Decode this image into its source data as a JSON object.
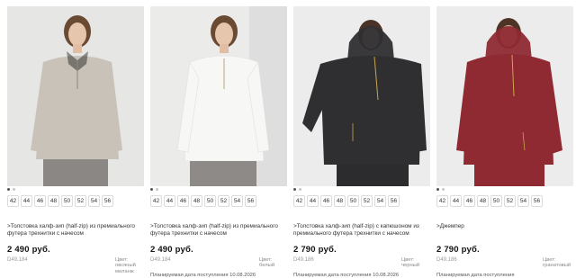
{
  "products": [
    {
      "title": ">Толстовка халф-зип (half-zip) из премиального футера трехнитки с начесом",
      "price": "2 490 руб.",
      "sku": "D49.184",
      "color_label": "Цвет:",
      "color_value": "овсяный меланж",
      "arrival": "",
      "sizes": [
        "42",
        "44",
        "46",
        "48",
        "50",
        "52",
        "54",
        "56"
      ],
      "garment_color": "#c9c2b8",
      "bg_color": "#e6e6e4"
    },
    {
      "title": ">Толстовка халф-зип (half-zip) из премиального футера трехнитки с начесом",
      "price": "2 490 руб.",
      "sku": "D49.184",
      "color_label": "Цвет:",
      "color_value": "белый",
      "arrival": "Планируемая дата поступления 10.08.2026",
      "sizes": [
        "42",
        "44",
        "46",
        "48",
        "50",
        "52",
        "54",
        "56"
      ],
      "garment_color": "#f7f7f5",
      "bg_color": "#ebebea"
    },
    {
      "title": ">Толстовка халф-зип (half-zip) с капюшоном из премиального футера трехнитки с начесом",
      "price": "2 790 руб.",
      "sku": "D49.186",
      "color_label": "Цвет:",
      "color_value": "черный",
      "arrival": "Планируемая дата поступления 10.08.2026",
      "sizes": [
        "42",
        "44",
        "46",
        "48",
        "50",
        "52",
        "54",
        "56"
      ],
      "garment_color": "#2f2f31",
      "bg_color": "#ececec"
    },
    {
      "title": ">Джемпер",
      "price": "2 790 руб.",
      "sku": "D49.186",
      "color_label": "Цвет:",
      "color_value": "гранатовый",
      "arrival": "Планируемая дата поступления",
      "sizes": [
        "42",
        "44",
        "46",
        "48",
        "50",
        "52",
        "54",
        "56"
      ],
      "garment_color": "#8f2a33",
      "bg_color": "#ececec"
    }
  ]
}
